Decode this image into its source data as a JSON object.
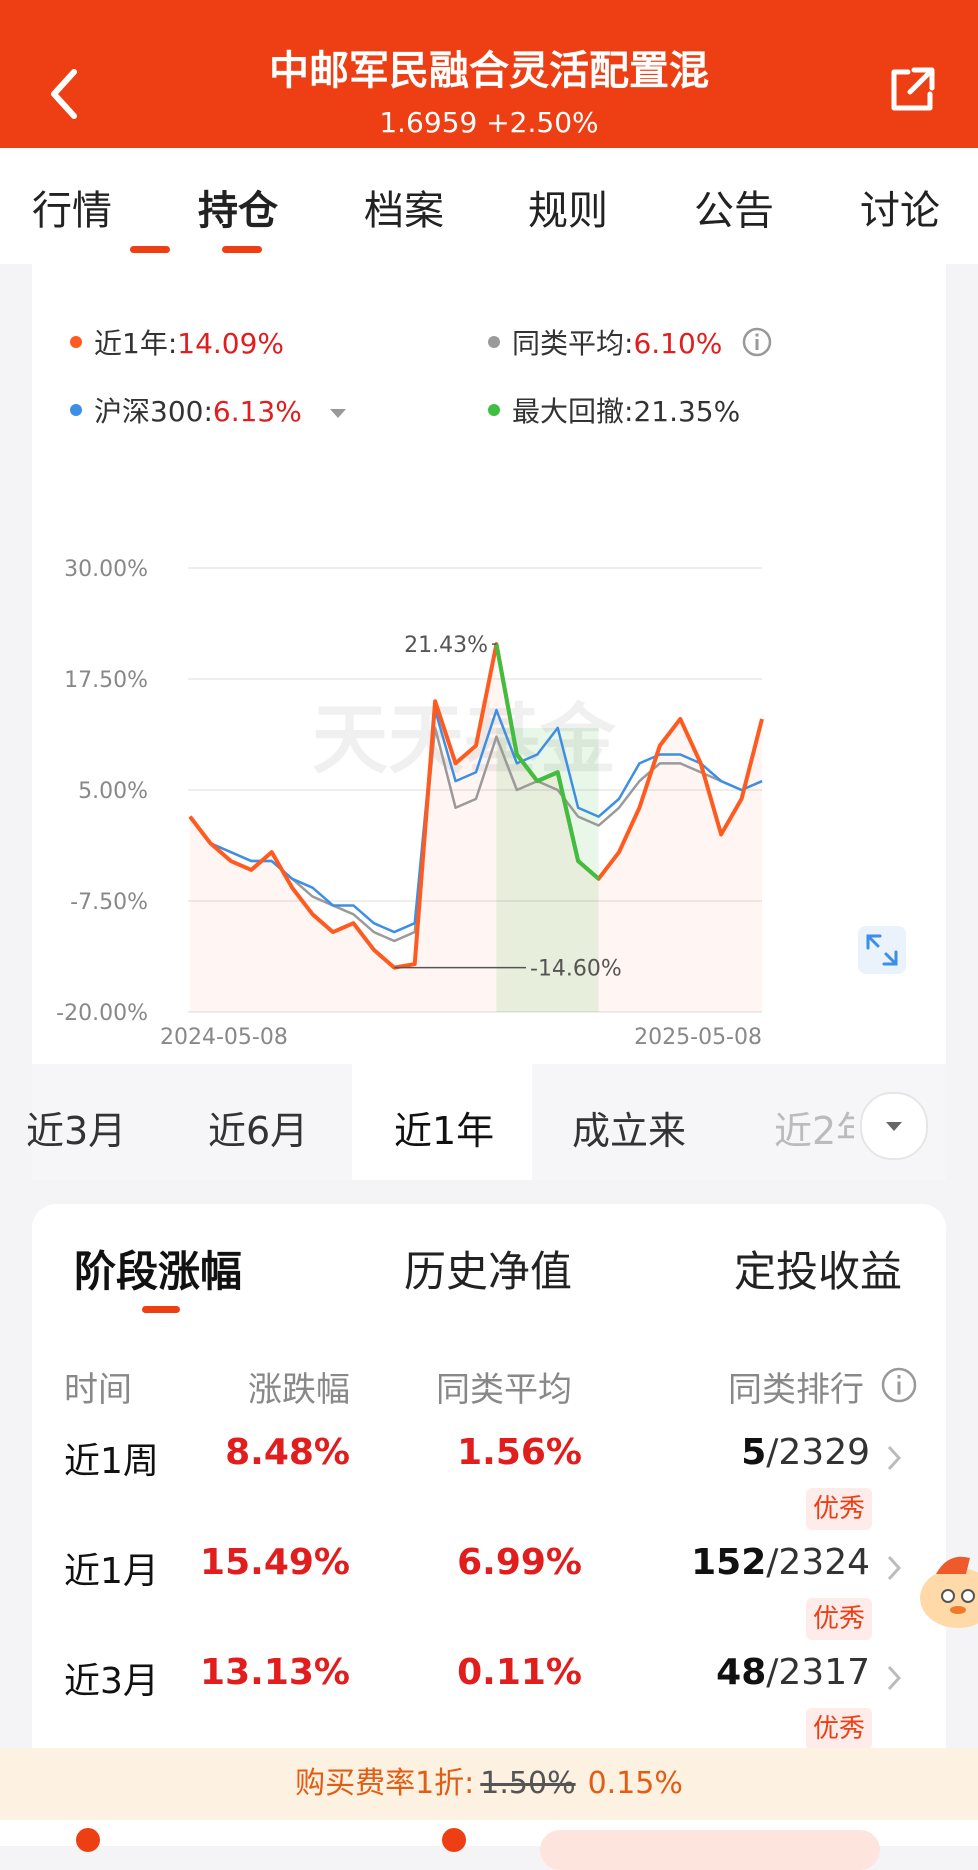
{
  "header": {
    "title": "中邮军民融合灵活配置混",
    "nav": "1.6959  +2.50%"
  },
  "tabs": [
    "行情",
    "持仓",
    "档案",
    "规则",
    "公告",
    "讨论"
  ],
  "legend": {
    "one_year": {
      "label": "近1年:",
      "value": "14.09%"
    },
    "category_avg": {
      "label": "同类平均:",
      "value": "6.10%"
    },
    "hs300": {
      "label": "沪深300:",
      "value": "6.13%"
    },
    "max_drawdown": {
      "label": "最大回撤:",
      "value": "21.35%"
    }
  },
  "colors": {
    "fund": "#ff5a1f",
    "avg": "#9a9a9a",
    "index": "#3d8fe6",
    "drawdown": "#3fbf3f",
    "brand": "#ee3f14"
  },
  "chart_data": {
    "type": "line",
    "y_ticks": [
      "30.00%",
      "17.50%",
      "5.00%",
      "-7.50%",
      "-20.00%"
    ],
    "ylim": [
      -20,
      30
    ],
    "x_ticks": [
      "2024-05-08",
      "2025-05-08"
    ],
    "watermark": "天天基金",
    "annotations": {
      "high": "21.43%",
      "low": "-14.60%"
    },
    "series": [
      {
        "key": "fund",
        "values": [
          2,
          -1,
          -3,
          -4,
          -2,
          -6,
          -9,
          -11,
          -10,
          -13,
          -15,
          -14.6,
          15,
          8,
          10,
          21.43,
          9,
          6,
          7,
          -3,
          -5,
          -2,
          3,
          10,
          13,
          8,
          0,
          4,
          13
        ]
      },
      {
        "key": "avg",
        "values": [
          2,
          -1,
          -2,
          -3,
          -3,
          -5,
          -7,
          -8,
          -9,
          -11,
          -12,
          -11,
          12,
          3,
          4,
          11,
          5,
          6,
          5,
          2,
          1,
          3,
          6,
          8,
          8,
          7,
          6,
          5,
          6
        ]
      },
      {
        "key": "index",
        "values": [
          2,
          -1,
          -2,
          -3,
          -3,
          -5,
          -6,
          -8,
          -8,
          -10,
          -11,
          -10,
          14,
          6,
          7,
          14,
          8,
          9,
          12,
          3,
          2,
          4,
          8,
          9,
          9,
          8,
          6,
          5,
          6
        ]
      }
    ]
  },
  "periods": [
    "近3月",
    "近6月",
    "近1年",
    "成立来",
    "近2年"
  ],
  "section_tabs": [
    "阶段涨幅",
    "历史净值",
    "定投收益"
  ],
  "table": {
    "headers": [
      "时间",
      "涨跌幅",
      "同类平均",
      "同类排行"
    ],
    "rows": [
      {
        "name": "近1周",
        "change": "8.48%",
        "avg": "1.56%",
        "rank": "5",
        "total": "/2329",
        "badge": "优秀"
      },
      {
        "name": "近1月",
        "change": "15.49%",
        "avg": "6.99%",
        "rank": "152",
        "total": "/2324",
        "badge": "优秀"
      },
      {
        "name": "近3月",
        "change": "13.13%",
        "avg": "0.11%",
        "rank": "48",
        "total": "/2317",
        "badge": "优秀"
      }
    ]
  },
  "fee": {
    "label": "购买费率1折:",
    "original": "1.50%",
    "current": "0.15%"
  }
}
